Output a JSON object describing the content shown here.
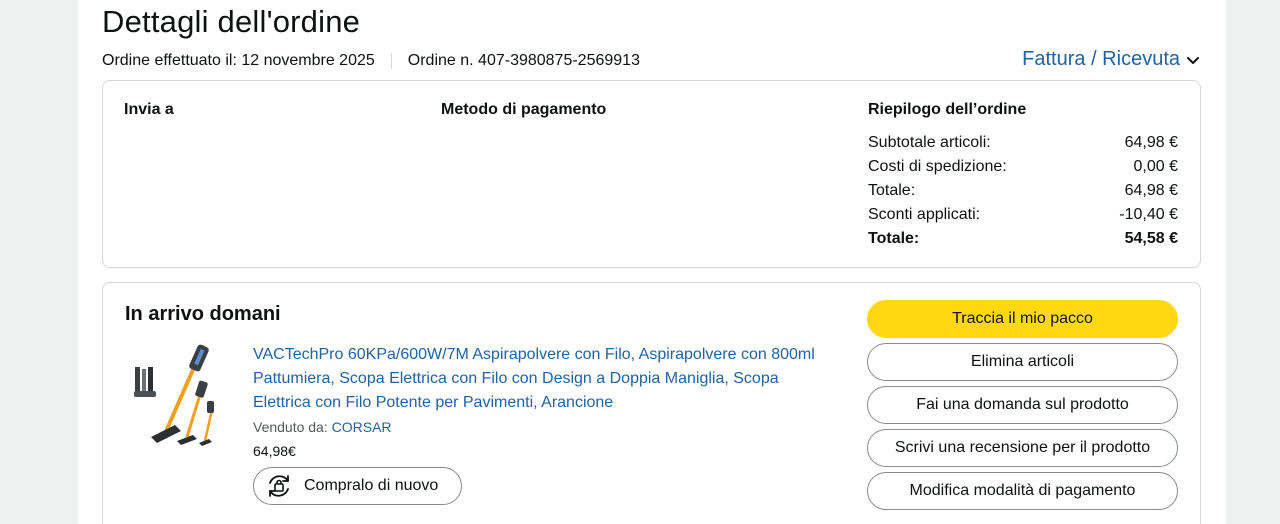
{
  "page": {
    "title": "Dettagli dell'ordine",
    "order_date": "Ordine effettuato il: 12 novembre 2025",
    "order_number": "Ordine n. 407-3980875-2569913",
    "invoice_link": "Fattura / Ricevuta",
    "invoice_icon": "chevron-down-icon"
  },
  "info": {
    "ship_to": "Invia a",
    "payment_method": "Metodo di pagamento",
    "summary_title": "Riepilogo dell’ordine",
    "summary_rows": [
      {
        "label": "Subtotale articoli:",
        "value": "64,98 €"
      },
      {
        "label": "Costi di spedizione:",
        "value": "0,00 €"
      },
      {
        "label": "Totale:",
        "value": "64,98 €"
      },
      {
        "label": "Sconti applicati:",
        "value": "-10,40 €"
      }
    ],
    "grand_total": {
      "label": "Totale:",
      "value": "54,58 €"
    }
  },
  "shipment": {
    "status": "In arrivo domani",
    "product": {
      "title": "VACTechPro 60KPa/600W/7M Aspirapolvere con Filo, Aspirapolvere con 800ml Pattumiera, Scopa Elettrica con Filo con Design a Doppia Maniglia, Scopa Elettrica con Filo Potente per Pavimenti, Arancione",
      "sold_by_label": "Venduto da:",
      "seller": "CORSAR",
      "price": "64,98€",
      "buy_again": "Compralo di nuovo",
      "buy_again_icon": "rebuy-icon"
    },
    "actions": {
      "track": "Traccia il mio pacco",
      "delete": "Elimina articoli",
      "question": "Fai una domanda sul prodotto",
      "review": "Scrivi una recensione per il prodotto",
      "payment": "Modifica modalità di pagamento"
    }
  },
  "colors": {
    "link": "#2162a1",
    "primary_button": "#ffd814",
    "background": "#f0f2f2"
  }
}
